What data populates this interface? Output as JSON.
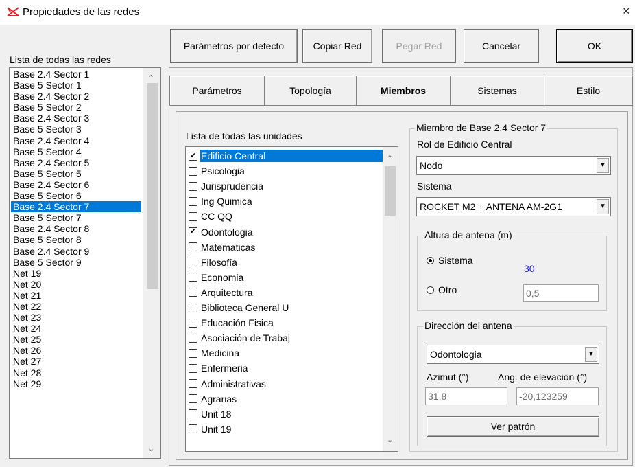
{
  "window": {
    "title": "Propiedades de las redes",
    "close": "×"
  },
  "toolbar": {
    "defaults": "Parámetros por defecto",
    "copy": "Copiar Red",
    "paste": "Pegar Red",
    "cancel": "Cancelar",
    "ok": "OK"
  },
  "networks": {
    "label": "Lista de todas las redes",
    "items": [
      "Base 2.4 Sector 1",
      "Base 5 Sector 1",
      "Base 2.4 Sector 2",
      "Base 5 Sector 2",
      "Base 2.4 Sector 3",
      "Base 5 Sector 3",
      "Base 2.4 Sector 4",
      "Base 5 Sector 4",
      "Base 2.4 Sector 5",
      "Base 5 Sector 5",
      "Base 2.4 Sector 6",
      "Base 5 Sector 6",
      "Base 2.4 Sector 7",
      "Base 5 Sector 7",
      "Base 2.4 Sector 8",
      "Base 5 Sector 8",
      "Base 2.4 Sector 9",
      "Base 5 Sector 9",
      "Net 19",
      "Net 20",
      "Net 21",
      "Net 22",
      "Net 23",
      "Net 24",
      "Net 25",
      "Net 26",
      "Net 27",
      "Net 28",
      "Net 29"
    ],
    "selected_index": 12
  },
  "tabs": [
    {
      "label": "Parámetros"
    },
    {
      "label": "Topología"
    },
    {
      "label": "Miembros"
    },
    {
      "label": "Sistemas"
    },
    {
      "label": "Estilo"
    }
  ],
  "active_tab": 2,
  "units": {
    "label": "Lista de todas las unidades",
    "items": [
      {
        "label": "Edificio Central",
        "checked": true
      },
      {
        "label": "Psicologia",
        "checked": false
      },
      {
        "label": "Jurisprudencia",
        "checked": false
      },
      {
        "label": "Ing Quimica",
        "checked": false
      },
      {
        "label": "CC QQ",
        "checked": false
      },
      {
        "label": "Odontologia",
        "checked": true
      },
      {
        "label": "Matematicas",
        "checked": false
      },
      {
        "label": "Filosofía",
        "checked": false
      },
      {
        "label": "Economia",
        "checked": false
      },
      {
        "label": "Arquitectura",
        "checked": false
      },
      {
        "label": "Biblioteca General U",
        "checked": false
      },
      {
        "label": "Educación Fisica",
        "checked": false
      },
      {
        "label": "Asociación de Trabaj",
        "checked": false
      },
      {
        "label": "Medicina",
        "checked": false
      },
      {
        "label": "Enfermeria",
        "checked": false
      },
      {
        "label": "Administrativas",
        "checked": false
      },
      {
        "label": "Agrarias",
        "checked": false
      },
      {
        "label": "Unit  18",
        "checked": false
      },
      {
        "label": "Unit  19",
        "checked": false
      }
    ],
    "selected_index": 0
  },
  "member": {
    "group_title": "Miembro de Base 2.4 Sector 7",
    "role_label": "Rol de Edificio Central",
    "role_value": "Nodo",
    "system_label": "Sistema",
    "system_value": "ROCKET M2 + ANTENA AM-2G1",
    "antenna_height": {
      "title": "Altura de antena (m)",
      "opt_system": "Sistema",
      "system_value": "30",
      "opt_other": "Otro",
      "other_value": "0,5"
    },
    "direction": {
      "title": "Dirección del antena",
      "target": "Odontologia",
      "azimuth_label": "Azimut (°)",
      "elevation_label": "Ang. de elevación (°)",
      "azimuth_value": "31,8",
      "elevation_value": "-20,123259",
      "pattern_button": "Ver patrón"
    }
  },
  "colors": {
    "selection": "#0078d7",
    "value_blue": "#1a1ad6"
  }
}
